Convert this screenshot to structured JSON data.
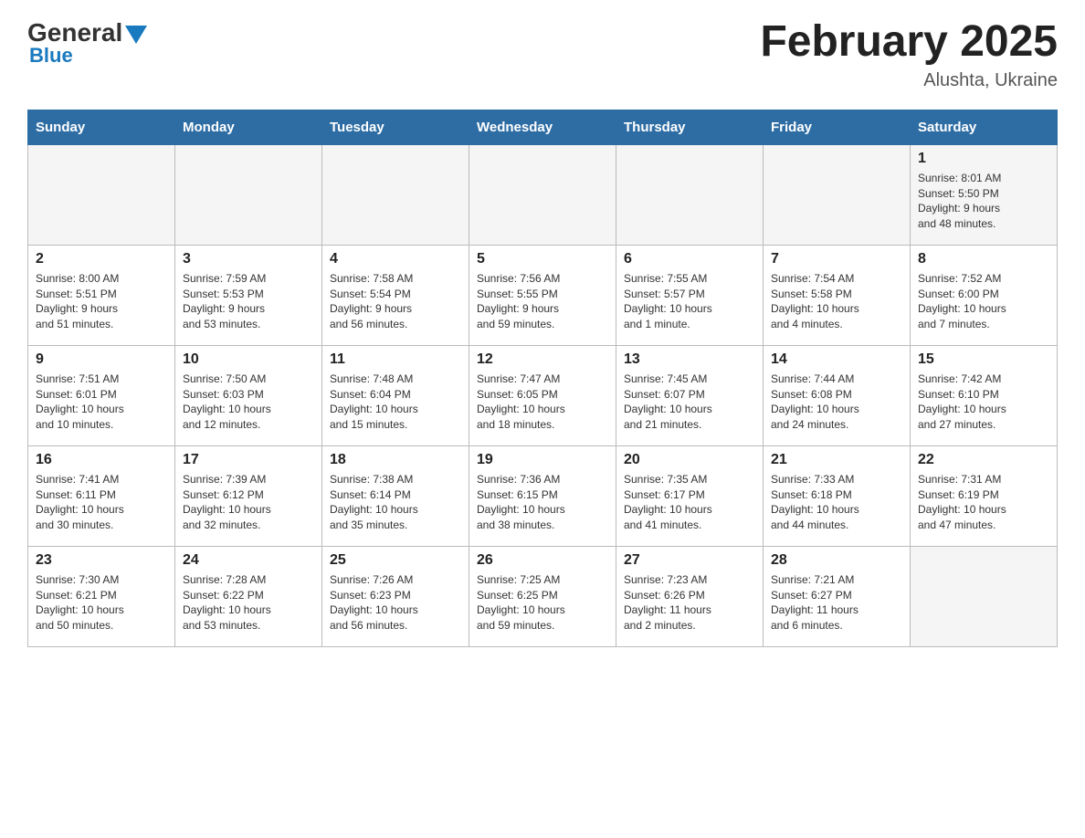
{
  "header": {
    "logo_general": "General",
    "logo_blue": "Blue",
    "month_title": "February 2025",
    "location": "Alushta, Ukraine"
  },
  "weekdays": [
    "Sunday",
    "Monday",
    "Tuesday",
    "Wednesday",
    "Thursday",
    "Friday",
    "Saturday"
  ],
  "weeks": [
    {
      "days": [
        {
          "number": "",
          "info": ""
        },
        {
          "number": "",
          "info": ""
        },
        {
          "number": "",
          "info": ""
        },
        {
          "number": "",
          "info": ""
        },
        {
          "number": "",
          "info": ""
        },
        {
          "number": "",
          "info": ""
        },
        {
          "number": "1",
          "info": "Sunrise: 8:01 AM\nSunset: 5:50 PM\nDaylight: 9 hours\nand 48 minutes."
        }
      ]
    },
    {
      "days": [
        {
          "number": "2",
          "info": "Sunrise: 8:00 AM\nSunset: 5:51 PM\nDaylight: 9 hours\nand 51 minutes."
        },
        {
          "number": "3",
          "info": "Sunrise: 7:59 AM\nSunset: 5:53 PM\nDaylight: 9 hours\nand 53 minutes."
        },
        {
          "number": "4",
          "info": "Sunrise: 7:58 AM\nSunset: 5:54 PM\nDaylight: 9 hours\nand 56 minutes."
        },
        {
          "number": "5",
          "info": "Sunrise: 7:56 AM\nSunset: 5:55 PM\nDaylight: 9 hours\nand 59 minutes."
        },
        {
          "number": "6",
          "info": "Sunrise: 7:55 AM\nSunset: 5:57 PM\nDaylight: 10 hours\nand 1 minute."
        },
        {
          "number": "7",
          "info": "Sunrise: 7:54 AM\nSunset: 5:58 PM\nDaylight: 10 hours\nand 4 minutes."
        },
        {
          "number": "8",
          "info": "Sunrise: 7:52 AM\nSunset: 6:00 PM\nDaylight: 10 hours\nand 7 minutes."
        }
      ]
    },
    {
      "days": [
        {
          "number": "9",
          "info": "Sunrise: 7:51 AM\nSunset: 6:01 PM\nDaylight: 10 hours\nand 10 minutes."
        },
        {
          "number": "10",
          "info": "Sunrise: 7:50 AM\nSunset: 6:03 PM\nDaylight: 10 hours\nand 12 minutes."
        },
        {
          "number": "11",
          "info": "Sunrise: 7:48 AM\nSunset: 6:04 PM\nDaylight: 10 hours\nand 15 minutes."
        },
        {
          "number": "12",
          "info": "Sunrise: 7:47 AM\nSunset: 6:05 PM\nDaylight: 10 hours\nand 18 minutes."
        },
        {
          "number": "13",
          "info": "Sunrise: 7:45 AM\nSunset: 6:07 PM\nDaylight: 10 hours\nand 21 minutes."
        },
        {
          "number": "14",
          "info": "Sunrise: 7:44 AM\nSunset: 6:08 PM\nDaylight: 10 hours\nand 24 minutes."
        },
        {
          "number": "15",
          "info": "Sunrise: 7:42 AM\nSunset: 6:10 PM\nDaylight: 10 hours\nand 27 minutes."
        }
      ]
    },
    {
      "days": [
        {
          "number": "16",
          "info": "Sunrise: 7:41 AM\nSunset: 6:11 PM\nDaylight: 10 hours\nand 30 minutes."
        },
        {
          "number": "17",
          "info": "Sunrise: 7:39 AM\nSunset: 6:12 PM\nDaylight: 10 hours\nand 32 minutes."
        },
        {
          "number": "18",
          "info": "Sunrise: 7:38 AM\nSunset: 6:14 PM\nDaylight: 10 hours\nand 35 minutes."
        },
        {
          "number": "19",
          "info": "Sunrise: 7:36 AM\nSunset: 6:15 PM\nDaylight: 10 hours\nand 38 minutes."
        },
        {
          "number": "20",
          "info": "Sunrise: 7:35 AM\nSunset: 6:17 PM\nDaylight: 10 hours\nand 41 minutes."
        },
        {
          "number": "21",
          "info": "Sunrise: 7:33 AM\nSunset: 6:18 PM\nDaylight: 10 hours\nand 44 minutes."
        },
        {
          "number": "22",
          "info": "Sunrise: 7:31 AM\nSunset: 6:19 PM\nDaylight: 10 hours\nand 47 minutes."
        }
      ]
    },
    {
      "days": [
        {
          "number": "23",
          "info": "Sunrise: 7:30 AM\nSunset: 6:21 PM\nDaylight: 10 hours\nand 50 minutes."
        },
        {
          "number": "24",
          "info": "Sunrise: 7:28 AM\nSunset: 6:22 PM\nDaylight: 10 hours\nand 53 minutes."
        },
        {
          "number": "25",
          "info": "Sunrise: 7:26 AM\nSunset: 6:23 PM\nDaylight: 10 hours\nand 56 minutes."
        },
        {
          "number": "26",
          "info": "Sunrise: 7:25 AM\nSunset: 6:25 PM\nDaylight: 10 hours\nand 59 minutes."
        },
        {
          "number": "27",
          "info": "Sunrise: 7:23 AM\nSunset: 6:26 PM\nDaylight: 11 hours\nand 2 minutes."
        },
        {
          "number": "28",
          "info": "Sunrise: 7:21 AM\nSunset: 6:27 PM\nDaylight: 11 hours\nand 6 minutes."
        },
        {
          "number": "",
          "info": ""
        }
      ]
    }
  ]
}
